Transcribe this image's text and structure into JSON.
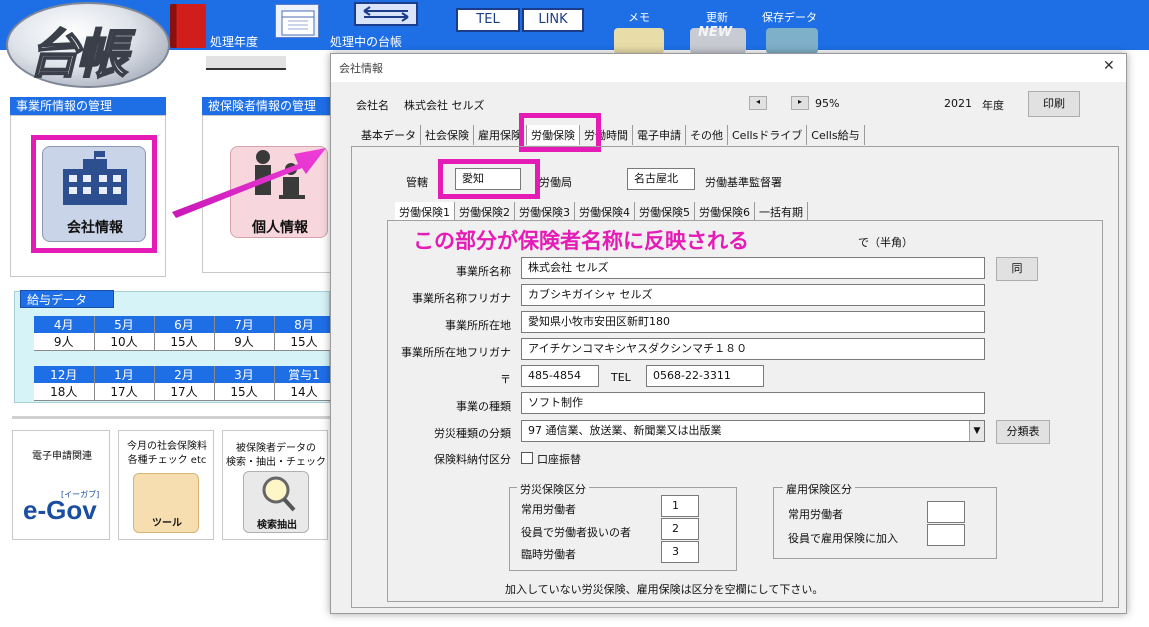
{
  "app": {
    "logo_text": "台帳",
    "year_label": "処理年度",
    "ledger_label": "処理中の台帳",
    "tel_button": "TEL",
    "link_button": "LINK",
    "memo_label": "メモ",
    "update_label": "更新",
    "update_badge": "NEW",
    "save_label": "保存データ"
  },
  "left": {
    "office_header": "事業所情報の管理",
    "insured_header": "被保険者情報の管理",
    "company_info": "会社情報",
    "personal_info": "個人情報",
    "payroll_header": "給与データ",
    "payroll_row1_months": [
      "4月",
      "5月",
      "6月",
      "7月",
      "8月"
    ],
    "payroll_row1_counts": [
      "9人",
      "10人",
      "15人",
      "9人",
      "15人"
    ],
    "payroll_row2_months": [
      "12月",
      "1月",
      "2月",
      "3月",
      "賞与1"
    ],
    "payroll_row2_counts": [
      "18人",
      "17人",
      "17人",
      "15人",
      "14人"
    ],
    "egov_label": "電子申請関連",
    "egov_logo": "e-Gov",
    "egov_sub": "[イーガブ]",
    "tools_label_1": "今月の社会保険料",
    "tools_label_2": "各種チェック etc",
    "tools_icon_text": "ツール",
    "search_label_1": "被保険者データの",
    "search_label_2": "検索・抽出・チェック",
    "search_button": "検索抽出"
  },
  "dialog": {
    "title": "会社情報",
    "company_label": "会社名",
    "company_name": "株式会社 セルズ",
    "zoom": "95%",
    "year": "2021",
    "year_suffix": "年度",
    "print_button": "印刷",
    "tabs": [
      "基本データ",
      "社会保険",
      "雇用保険",
      "労働保険",
      "労働時間",
      "電子申請",
      "その他",
      "Cellsドライブ",
      "Cells給与"
    ],
    "jurisdiction_label": "管轄",
    "jurisdiction_value": "愛知",
    "labor_bureau_suffix": "労働局",
    "inspection_office_value": "名古屋北",
    "inspection_office_suffix": "労働基準監督署",
    "sub_tabs": [
      "労働保険1",
      "労働保険2",
      "労働保険3",
      "労働保険4",
      "労働保険5",
      "労働保険6",
      "一括有期"
    ],
    "annotation": "この部分が保険者名称に反映される",
    "annotation_tail": "で（半角）",
    "fields": {
      "office_name_label": "事業所名称",
      "office_name": "株式会社 セルズ",
      "same_button": "同",
      "office_kana_label": "事業所名称フリガナ",
      "office_kana": "カブシキガイシャ セルズ",
      "address_label": "事業所所在地",
      "address": "愛知県小牧市安田区新町180",
      "address_kana_label": "事業所所在地フリガナ",
      "address_kana": "アイチケンコマキシヤスダクシンマチ１８０",
      "postal_label": "〒",
      "postal": "485-4854",
      "tel_label": "TEL",
      "tel": "0568-22-3311",
      "business_type_label": "事業の種類",
      "business_type": "ソフト制作",
      "accident_class_label": "労災種類の分類",
      "accident_class": "97 通信業、放送業、新聞業又は出版業",
      "class_table_button": "分類表",
      "payment_label": "保険料納付区分",
      "bank_transfer_label": "口座振替"
    },
    "accident_group": {
      "title": "労災保険区分",
      "rows": [
        {
          "label": "常用労働者",
          "value": "1"
        },
        {
          "label": "役員で労働者扱いの者",
          "value": "2"
        },
        {
          "label": "臨時労働者",
          "value": "3"
        }
      ]
    },
    "employment_group": {
      "title": "雇用保険区分",
      "rows": [
        {
          "label": "常用労働者",
          "value": ""
        },
        {
          "label": "役員で雇用保険に加入",
          "value": ""
        }
      ]
    },
    "footer_note": "加入していない労災保険、雇用保険は区分を空欄にして下さい。"
  },
  "colors": {
    "topbar": "#1e6fe6",
    "highlight": "#e51bb6",
    "annotation_text": "#e51bb6"
  }
}
